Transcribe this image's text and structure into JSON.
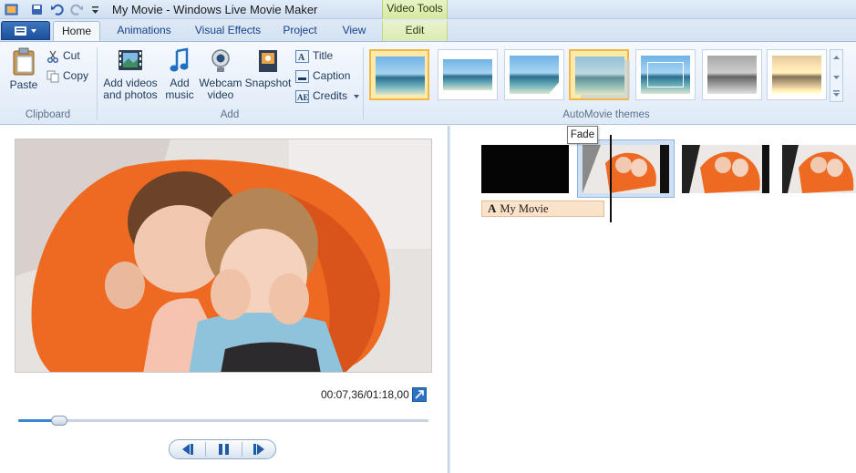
{
  "window": {
    "title": "My Movie - Windows Live Movie Maker",
    "context_tab_group": "Video Tools"
  },
  "tabs": [
    {
      "label": "Home",
      "active": true
    },
    {
      "label": "Animations"
    },
    {
      "label": "Visual Effects"
    },
    {
      "label": "Project"
    },
    {
      "label": "View"
    },
    {
      "label": "Edit",
      "context": true
    }
  ],
  "ribbon": {
    "clipboard": {
      "group_label": "Clipboard",
      "paste": "Paste",
      "cut": "Cut",
      "copy": "Copy"
    },
    "add": {
      "group_label": "Add",
      "add_videos_line1": "Add videos",
      "add_videos_line2": "and photos",
      "add_music_line1": "Add",
      "add_music_line2": "music",
      "webcam_line1": "Webcam",
      "webcam_line2": "video",
      "snapshot": "Snapshot",
      "title": "Title",
      "caption": "Caption",
      "credits": "Credits"
    },
    "themes": {
      "group_label": "AutoMovie themes",
      "items": [
        {
          "name": "theme-default",
          "selected": true
        },
        {
          "name": "theme-contemporary"
        },
        {
          "name": "theme-cinematic"
        },
        {
          "name": "theme-fade",
          "selected": true
        },
        {
          "name": "theme-pan-zoom"
        },
        {
          "name": "theme-black-white"
        },
        {
          "name": "theme-sepia"
        }
      ]
    }
  },
  "preview": {
    "timecode": "00:07,36/01:18,00",
    "seek_fraction": 0.094
  },
  "storyboard": {
    "caption_text": "My Movie",
    "caption_glyph": "A",
    "tooltip": "Fade"
  },
  "colors": {
    "accent_blue": "#2a72c2",
    "context_green": "#d7e9a1",
    "selected_theme": "#f2b846",
    "caption_bg": "#fbe3cb"
  }
}
